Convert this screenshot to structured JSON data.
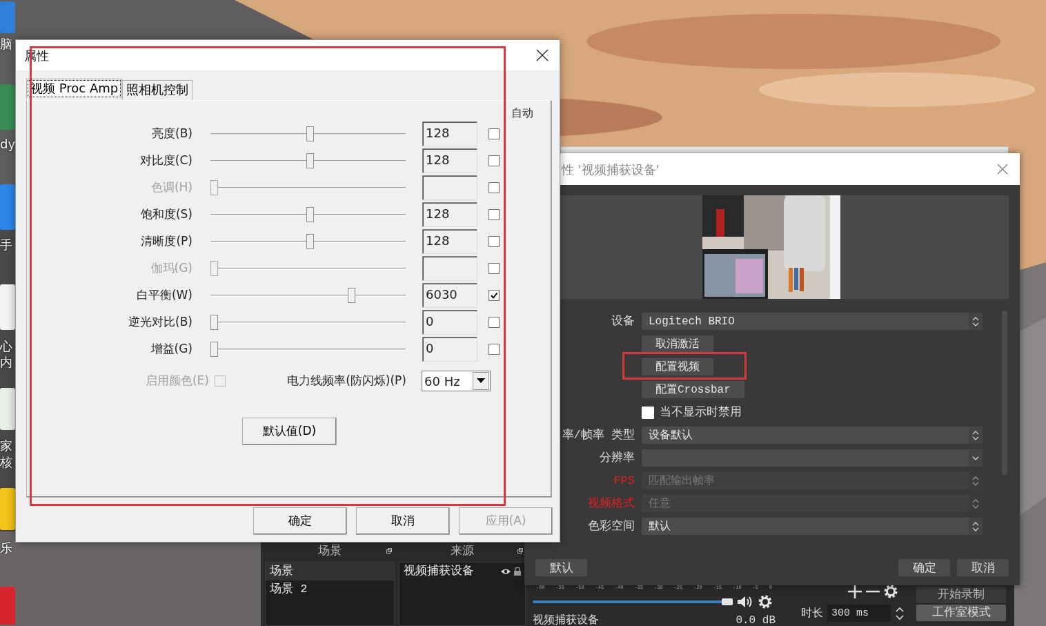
{
  "desktop": {
    "labels": [
      {
        "text": "脑"
      },
      {
        "text": "dy"
      },
      {
        "text": "手"
      },
      {
        "text": "心"
      },
      {
        "text": "内"
      },
      {
        "text": "家"
      },
      {
        "text": "核"
      },
      {
        "text": "乐"
      }
    ]
  },
  "obs_main": {
    "scenes": {
      "title": "场景",
      "items": [
        {
          "label": "场景",
          "selected": true
        },
        {
          "label": "场景 2",
          "selected": false
        }
      ]
    },
    "sources": {
      "title": "来源",
      "items": [
        {
          "label": "视频捕获设备",
          "selected": false
        }
      ]
    },
    "mixer": {
      "ticks": [
        "-60",
        "-55",
        "-50",
        "-45",
        "-40",
        "-35",
        "-30",
        "-25",
        "-20",
        "-15",
        "-10",
        "-5",
        "0"
      ],
      "channel": {
        "name": "视频捕获设备",
        "reading": "0.0 dB",
        "level": 1
      }
    },
    "transition": {
      "duration_label": "时长",
      "duration": "300 ms"
    },
    "controls": [
      {
        "label": "开始录制",
        "selected": false
      },
      {
        "label": "工作室模式",
        "selected": true
      }
    ]
  },
  "source_properties": {
    "title": "性 '视频捕获设备'",
    "fields": [
      {
        "kind": "select",
        "label": "设备",
        "value": "Logitech BRIO",
        "disabled": false,
        "warning": false
      },
      {
        "kind": "button",
        "value": "取消激活",
        "highlighted": false
      },
      {
        "kind": "button",
        "value": "配置视频",
        "highlighted": true
      },
      {
        "kind": "button",
        "value": "配置Crossbar",
        "highlighted": false
      },
      {
        "kind": "checkbox",
        "value": "当不显示时禁用",
        "checked": false
      },
      {
        "kind": "select",
        "label": "率/帧率 类型",
        "value": "设备默认",
        "disabled": false,
        "warning": false
      },
      {
        "kind": "dropdown",
        "label": "分辨率",
        "disabled": false,
        "warning": false
      },
      {
        "kind": "select",
        "label": "FPS",
        "value": "匹配输出帧率",
        "disabled": true,
        "warning": true
      },
      {
        "kind": "select",
        "label": "视频格式",
        "value": "任意",
        "disabled": true,
        "warning": true
      },
      {
        "kind": "select",
        "label": "色彩空间",
        "value": "默认",
        "disabled": false,
        "warning": false
      }
    ],
    "footer": {
      "defaults": "默认",
      "ok": "确定",
      "cancel": "取消"
    }
  },
  "properties_dialog": {
    "title": "属性",
    "highlighted": true,
    "tabs": [
      {
        "label": "视频 Proc Amp",
        "selected": true
      },
      {
        "label": "照相机控制",
        "selected": false
      }
    ],
    "auto_header": "自动",
    "rows": [
      {
        "label": "亮度(B)",
        "level": 0.51,
        "value": "128",
        "auto": false,
        "disabled": false
      },
      {
        "label": "对比度(C)",
        "level": 0.51,
        "value": "128",
        "auto": false,
        "disabled": false
      },
      {
        "label": "色调(H)",
        "level": 0,
        "auto": false,
        "disabled": true
      },
      {
        "label": "饱和度(S)",
        "level": 0.51,
        "value": "128",
        "auto": false,
        "disabled": false
      },
      {
        "label": "清晰度(P)",
        "level": 0.51,
        "value": "128",
        "auto": false,
        "disabled": false
      },
      {
        "label": "伽玛(G)",
        "level": 0,
        "auto": false,
        "disabled": true
      },
      {
        "label": "白平衡(W)",
        "level": 0.73,
        "value": "6030",
        "auto": true,
        "disabled": false
      },
      {
        "label": "逆光对比(B)",
        "level": 0,
        "value": "0",
        "auto": false,
        "disabled": false
      },
      {
        "label": "增益(G)",
        "level": 0,
        "value": "0",
        "auto": false,
        "disabled": false
      }
    ],
    "enable_color": {
      "label": "启用颜色(E)",
      "checked": false,
      "disabled": true
    },
    "powerline": {
      "label": "电力线频率(防闪烁)(P)",
      "value": "60 Hz"
    },
    "default_button": "默认值(D)",
    "buttons": [
      {
        "label": "确定",
        "disabled": false
      },
      {
        "label": "取消",
        "disabled": false
      },
      {
        "label": "应用(A)",
        "disabled": true
      }
    ]
  }
}
